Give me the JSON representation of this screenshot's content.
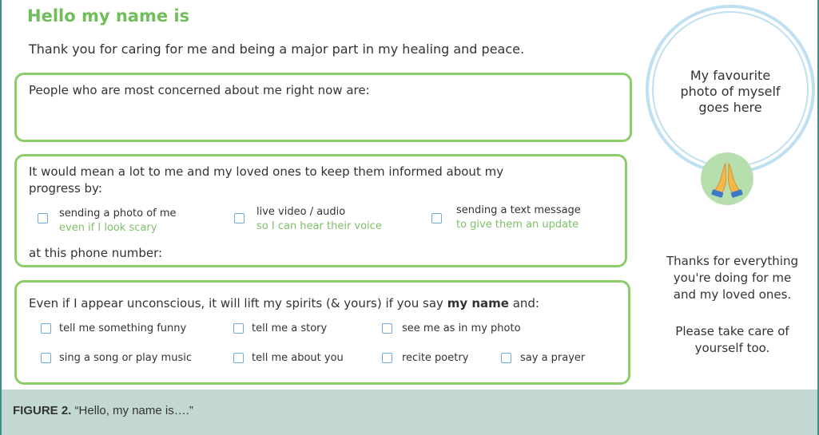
{
  "header": {
    "title": "Hello my name is",
    "subtitle": "Thank you for caring for me and being a major part in my healing and peace."
  },
  "concerned": {
    "prompt": "People who are most concerned about me right now are:"
  },
  "inform": {
    "prompt_line1": "It would mean a lot to me and my loved ones to keep them informed about my",
    "prompt_line2": "progress by:",
    "options": [
      {
        "label": "sending a photo of me",
        "sub": "even if I look scary"
      },
      {
        "label": "live video / audio",
        "sub": "so I can hear their voice"
      },
      {
        "label": "sending a text message",
        "sub": "to give them an update"
      }
    ],
    "phone_label": "at this phone number:"
  },
  "spirits": {
    "prompt_before": "Even if I appear unconscious, it will lift my spirits (& yours) if you say",
    "prompt_bold": "my name",
    "prompt_after": "and:",
    "options": [
      "tell me something funny",
      "tell me a story",
      "see me as in my photo",
      "sing a song or play music",
      "tell me about you",
      "recite poetry",
      "say a prayer"
    ]
  },
  "photo": {
    "line1": "My favourite",
    "line2": "photo of myself",
    "line3": "goes here",
    "icon": "praying-hands-icon"
  },
  "thanks": {
    "line1": "Thanks for everything",
    "line2": "you're doing for me",
    "line3": "and my loved ones.",
    "line4": "Please take care of",
    "line5": "yourself too."
  },
  "caption": {
    "label": "FIGURE 2.",
    "text": "“Hello, my name is….”"
  },
  "colors": {
    "green_heading": "#6fbe5a",
    "box_border": "#8ccc6a",
    "checkbox_border": "#6fa9e0",
    "circle_border": "#bfe0f0",
    "caption_bg": "#c3d8d3",
    "side_rule": "#3a8f86"
  }
}
